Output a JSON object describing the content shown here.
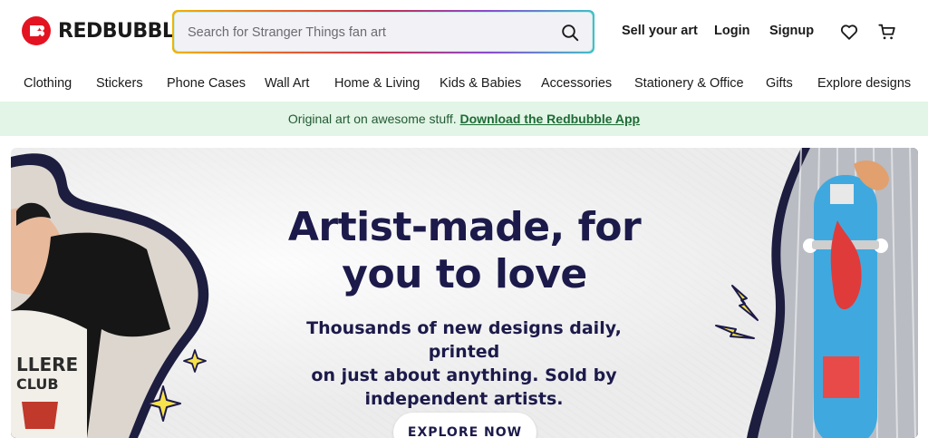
{
  "header": {
    "logo_text": "REDBUBBLE",
    "search": {
      "placeholder": "Search for Stranger Things fan art",
      "value": ""
    },
    "sell_label": "Sell your art",
    "login_label": "Login",
    "signup_label": "Signup",
    "icons": [
      "search-icon",
      "heart-icon",
      "cart-icon"
    ]
  },
  "categories": [
    "Clothing",
    "Stickers",
    "Phone Cases",
    "Wall Art",
    "Home & Living",
    "Kids & Babies",
    "Accessories",
    "Stationery & Office",
    "Gifts",
    "Explore designs"
  ],
  "banner": {
    "text": "Original art on awesome stuff.",
    "link": "Download the Redbubble App"
  },
  "hero": {
    "title_line1": "Artist-made, for",
    "title_line2": "you to love",
    "sub_line1": "Thousands of new designs daily, printed",
    "sub_line2": "on just about anything. Sold by",
    "sub_line3": "independent artists.",
    "button_label": "EXPLORE NOW"
  },
  "colors": {
    "brand_red": "#e41321",
    "banner_bg": "#e2f5e6",
    "banner_link": "#1e6b35",
    "hero_text": "#1c1a4a"
  }
}
